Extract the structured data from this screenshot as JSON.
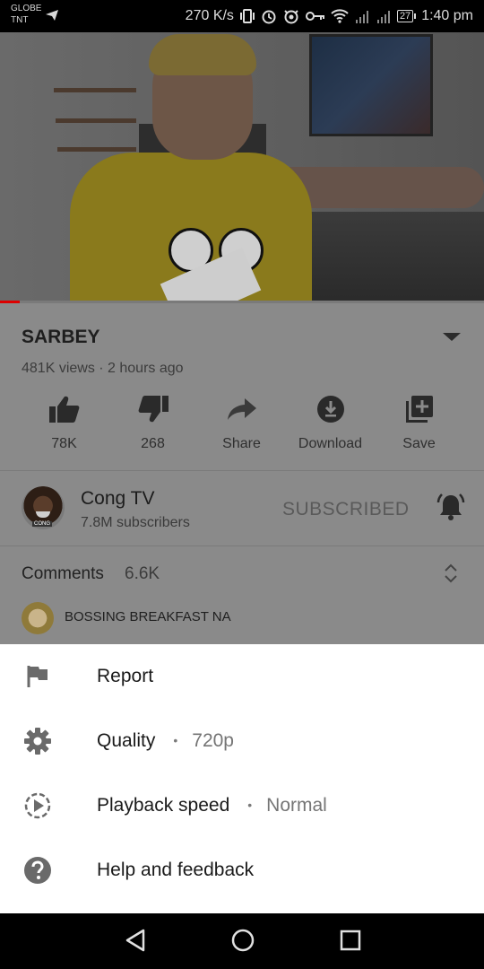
{
  "status_bar": {
    "carrier_line1": "GLOBE",
    "carrier_line2": "TNT",
    "net_speed": "270 K/s",
    "battery": "27",
    "time": "1:40 pm"
  },
  "video": {
    "title": "SARBEY",
    "meta": "481K views · 2 hours ago",
    "progress_fraction": 0.04
  },
  "actions": [
    {
      "icon": "thumbs-up-icon",
      "label": "78K"
    },
    {
      "icon": "thumbs-down-icon",
      "label": "268"
    },
    {
      "icon": "share-icon",
      "label": "Share"
    },
    {
      "icon": "download-icon",
      "label": "Download"
    },
    {
      "icon": "add-to-playlist-icon",
      "label": "Save"
    }
  ],
  "channel": {
    "name": "Cong TV",
    "subscribers": "7.8M subscribers",
    "subscribe_state": "SUBSCRIBED"
  },
  "comments": {
    "label": "Comments",
    "count": "6.6K",
    "top_comment": "BOSSING BREAKFAST NA"
  },
  "menu": {
    "report": {
      "label": "Report"
    },
    "quality": {
      "label": "Quality",
      "separator": "•",
      "value": "720p"
    },
    "playback_speed": {
      "label": "Playback speed",
      "separator": "•",
      "value": "Normal"
    },
    "help": {
      "label": "Help and feedback"
    }
  },
  "colors": {
    "sheet_background": "#ffffff",
    "scrim": "#8a8a8a",
    "progress_red": "#dd0000"
  }
}
